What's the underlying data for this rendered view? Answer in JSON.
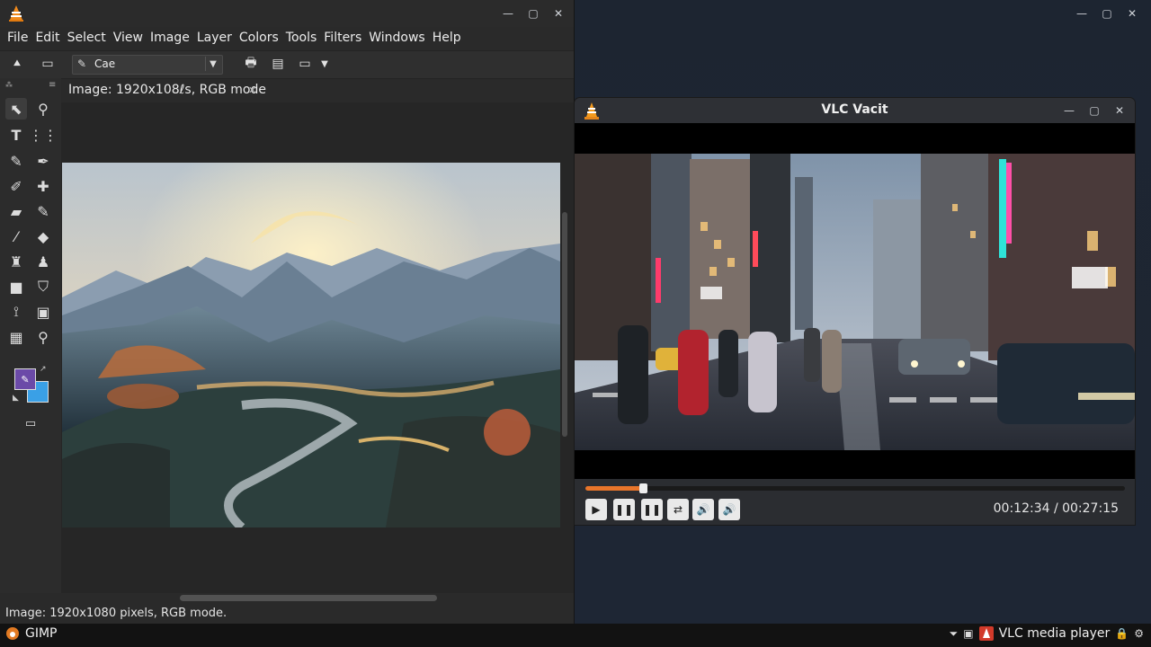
{
  "gimp": {
    "menu": [
      "File",
      "Edit",
      "Select",
      "View",
      "Image",
      "Layer",
      "Colors",
      "Tools",
      "Filters",
      "Windows",
      "Help"
    ],
    "font_name": "Cae",
    "image_tab": "Image: 1920x108ℓs, RGB mode",
    "status": "Image: 1920x1080 pixels, RGB mode."
  },
  "vlc": {
    "title": "VLC Vacit",
    "time": "00:12:34 / 00:27:15",
    "progress": 0.107
  },
  "taskbar": {
    "gimp_label": "GIMP",
    "vlc_label": "VLC media player"
  },
  "colors": {
    "fg": "#6b4aa8",
    "bg": "#3aa0e6",
    "seek": "#e8752a"
  }
}
